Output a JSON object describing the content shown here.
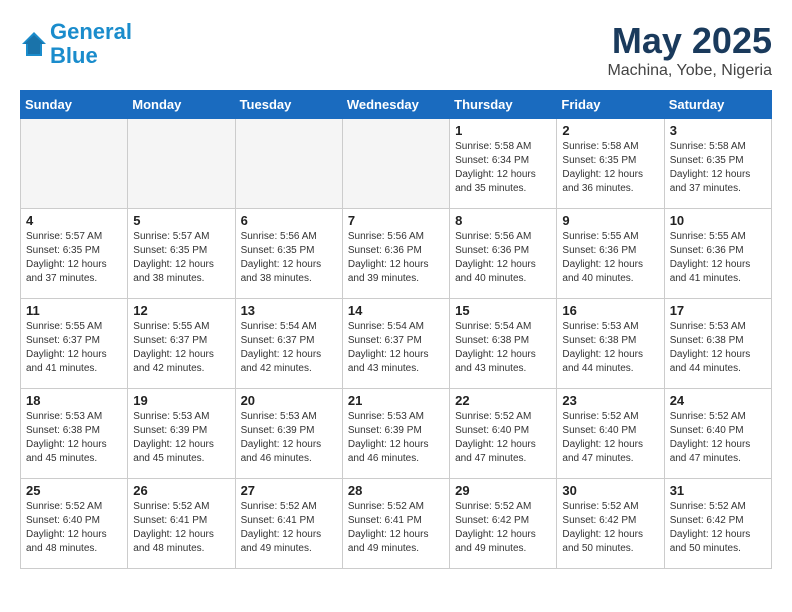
{
  "header": {
    "logo_line1": "General",
    "logo_line2": "Blue",
    "month": "May 2025",
    "location": "Machina, Yobe, Nigeria"
  },
  "weekdays": [
    "Sunday",
    "Monday",
    "Tuesday",
    "Wednesday",
    "Thursday",
    "Friday",
    "Saturday"
  ],
  "weeks": [
    [
      {
        "day": "",
        "sunrise": "",
        "sunset": "",
        "daylight": ""
      },
      {
        "day": "",
        "sunrise": "",
        "sunset": "",
        "daylight": ""
      },
      {
        "day": "",
        "sunrise": "",
        "sunset": "",
        "daylight": ""
      },
      {
        "day": "",
        "sunrise": "",
        "sunset": "",
        "daylight": ""
      },
      {
        "day": "1",
        "sunrise": "5:58 AM",
        "sunset": "6:34 PM",
        "daylight": "12 hours and 35 minutes."
      },
      {
        "day": "2",
        "sunrise": "5:58 AM",
        "sunset": "6:35 PM",
        "daylight": "12 hours and 36 minutes."
      },
      {
        "day": "3",
        "sunrise": "5:58 AM",
        "sunset": "6:35 PM",
        "daylight": "12 hours and 37 minutes."
      }
    ],
    [
      {
        "day": "4",
        "sunrise": "5:57 AM",
        "sunset": "6:35 PM",
        "daylight": "12 hours and 37 minutes."
      },
      {
        "day": "5",
        "sunrise": "5:57 AM",
        "sunset": "6:35 PM",
        "daylight": "12 hours and 38 minutes."
      },
      {
        "day": "6",
        "sunrise": "5:56 AM",
        "sunset": "6:35 PM",
        "daylight": "12 hours and 38 minutes."
      },
      {
        "day": "7",
        "sunrise": "5:56 AM",
        "sunset": "6:36 PM",
        "daylight": "12 hours and 39 minutes."
      },
      {
        "day": "8",
        "sunrise": "5:56 AM",
        "sunset": "6:36 PM",
        "daylight": "12 hours and 40 minutes."
      },
      {
        "day": "9",
        "sunrise": "5:55 AM",
        "sunset": "6:36 PM",
        "daylight": "12 hours and 40 minutes."
      },
      {
        "day": "10",
        "sunrise": "5:55 AM",
        "sunset": "6:36 PM",
        "daylight": "12 hours and 41 minutes."
      }
    ],
    [
      {
        "day": "11",
        "sunrise": "5:55 AM",
        "sunset": "6:37 PM",
        "daylight": "12 hours and 41 minutes."
      },
      {
        "day": "12",
        "sunrise": "5:55 AM",
        "sunset": "6:37 PM",
        "daylight": "12 hours and 42 minutes."
      },
      {
        "day": "13",
        "sunrise": "5:54 AM",
        "sunset": "6:37 PM",
        "daylight": "12 hours and 42 minutes."
      },
      {
        "day": "14",
        "sunrise": "5:54 AM",
        "sunset": "6:37 PM",
        "daylight": "12 hours and 43 minutes."
      },
      {
        "day": "15",
        "sunrise": "5:54 AM",
        "sunset": "6:38 PM",
        "daylight": "12 hours and 43 minutes."
      },
      {
        "day": "16",
        "sunrise": "5:53 AM",
        "sunset": "6:38 PM",
        "daylight": "12 hours and 44 minutes."
      },
      {
        "day": "17",
        "sunrise": "5:53 AM",
        "sunset": "6:38 PM",
        "daylight": "12 hours and 44 minutes."
      }
    ],
    [
      {
        "day": "18",
        "sunrise": "5:53 AM",
        "sunset": "6:38 PM",
        "daylight": "12 hours and 45 minutes."
      },
      {
        "day": "19",
        "sunrise": "5:53 AM",
        "sunset": "6:39 PM",
        "daylight": "12 hours and 45 minutes."
      },
      {
        "day": "20",
        "sunrise": "5:53 AM",
        "sunset": "6:39 PM",
        "daylight": "12 hours and 46 minutes."
      },
      {
        "day": "21",
        "sunrise": "5:53 AM",
        "sunset": "6:39 PM",
        "daylight": "12 hours and 46 minutes."
      },
      {
        "day": "22",
        "sunrise": "5:52 AM",
        "sunset": "6:40 PM",
        "daylight": "12 hours and 47 minutes."
      },
      {
        "day": "23",
        "sunrise": "5:52 AM",
        "sunset": "6:40 PM",
        "daylight": "12 hours and 47 minutes."
      },
      {
        "day": "24",
        "sunrise": "5:52 AM",
        "sunset": "6:40 PM",
        "daylight": "12 hours and 47 minutes."
      }
    ],
    [
      {
        "day": "25",
        "sunrise": "5:52 AM",
        "sunset": "6:40 PM",
        "daylight": "12 hours and 48 minutes."
      },
      {
        "day": "26",
        "sunrise": "5:52 AM",
        "sunset": "6:41 PM",
        "daylight": "12 hours and 48 minutes."
      },
      {
        "day": "27",
        "sunrise": "5:52 AM",
        "sunset": "6:41 PM",
        "daylight": "12 hours and 49 minutes."
      },
      {
        "day": "28",
        "sunrise": "5:52 AM",
        "sunset": "6:41 PM",
        "daylight": "12 hours and 49 minutes."
      },
      {
        "day": "29",
        "sunrise": "5:52 AM",
        "sunset": "6:42 PM",
        "daylight": "12 hours and 49 minutes."
      },
      {
        "day": "30",
        "sunrise": "5:52 AM",
        "sunset": "6:42 PM",
        "daylight": "12 hours and 50 minutes."
      },
      {
        "day": "31",
        "sunrise": "5:52 AM",
        "sunset": "6:42 PM",
        "daylight": "12 hours and 50 minutes."
      }
    ]
  ],
  "labels": {
    "sunrise": "Sunrise:",
    "sunset": "Sunset:",
    "daylight": "Daylight hours"
  }
}
